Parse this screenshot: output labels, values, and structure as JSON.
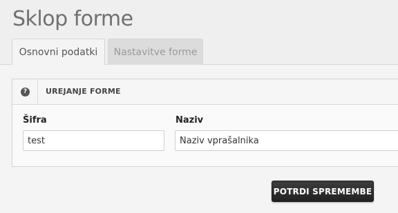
{
  "page": {
    "title": "Sklop forme"
  },
  "tabs": [
    {
      "label": "Osnovni podatki",
      "active": true
    },
    {
      "label": "Nastavitve forme",
      "active": false
    }
  ],
  "panel": {
    "icon": "help-icon",
    "title": "UREJANJE FORME",
    "fields": {
      "sifra": {
        "label": "Šifra",
        "value": "test"
      },
      "naziv": {
        "label": "Naziv",
        "value": "Naziv vprašalnika"
      }
    }
  },
  "actions": {
    "confirm_label": "POTRDI SPREMEMBE"
  },
  "colors": {
    "page_bg": "#efefef",
    "title": "#707070",
    "button_bg": "#2b2b2b",
    "button_text": "#ffffff"
  }
}
